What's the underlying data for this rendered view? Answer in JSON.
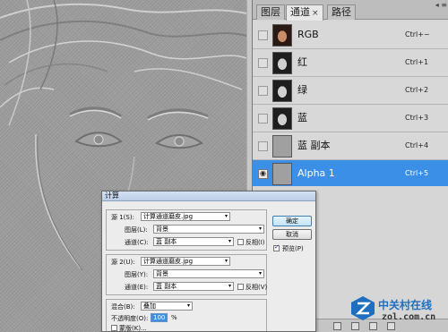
{
  "panel": {
    "tabs": [
      {
        "label": "图层"
      },
      {
        "label": "通道"
      },
      {
        "label": "路径"
      }
    ],
    "close_glyph": "×",
    "menu_glyph": "◂ ≡",
    "eye_glyph": "◉",
    "channels": [
      {
        "name": "RGB",
        "shortcut": "Ctrl+~",
        "thumb": "rgb",
        "visible": false,
        "selected": false
      },
      {
        "name": "红",
        "shortcut": "Ctrl+1",
        "thumb": "gray",
        "visible": false,
        "selected": false
      },
      {
        "name": "绿",
        "shortcut": "Ctrl+2",
        "thumb": "gray",
        "visible": false,
        "selected": false
      },
      {
        "name": "蓝",
        "shortcut": "Ctrl+3",
        "thumb": "gray",
        "visible": false,
        "selected": false
      },
      {
        "name": "蓝 副本",
        "shortcut": "Ctrl+4",
        "thumb": "texture",
        "visible": false,
        "selected": false
      },
      {
        "name": "Alpha 1",
        "shortcut": "Ctrl+5",
        "thumb": "texture",
        "visible": true,
        "selected": true
      }
    ],
    "bottom_icons": [
      "load-selection-icon",
      "save-selection-icon",
      "new-channel-icon",
      "delete-channel-icon"
    ]
  },
  "dialog": {
    "title": "计算",
    "source1": {
      "label": "源 1(S):",
      "file": "计算通道磨皮.jpg",
      "layer_label": "图层(L):",
      "layer": "背景",
      "channel_label": "通道(C):",
      "channel": "蓝 副本",
      "invert_label": "反相(I)",
      "invert": false
    },
    "source2": {
      "label": "源 2(U):",
      "file": "计算通道磨皮.jpg",
      "layer_label": "图层(Y):",
      "layer": "背景",
      "channel_label": "通道(E):",
      "channel": "蓝 副本",
      "invert_label": "反相(V)",
      "invert": false
    },
    "blending_label": "混合(B):",
    "blending": "叠加",
    "opacity_label": "不透明度(O):",
    "opacity": "100",
    "opacity_unit": "%",
    "mask_label": "蒙版(K)...",
    "mask": false,
    "ok_label": "确定",
    "cancel_label": "取消",
    "preview_label": "预览(P)",
    "preview": true,
    "arrow_glyph": "▾"
  },
  "watermark": {
    "name": "中关村在线",
    "url": "zol.com.cn"
  },
  "colors": {
    "selection_blue": "#3b8fe6",
    "panel_gray": "#d6d6d6",
    "canvas_gray": "#9c9c9c"
  }
}
